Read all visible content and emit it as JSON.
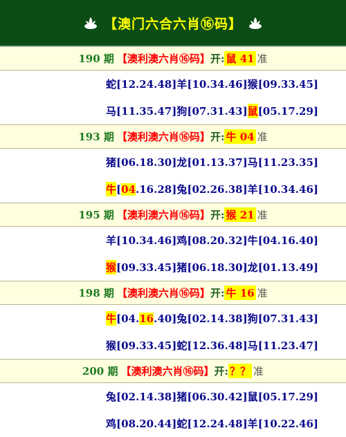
{
  "header": {
    "title": "【澳门六合六肖⑯码】"
  },
  "rounds": [
    {
      "period": "190 期",
      "title": "【澳利澳六肖⑯码】",
      "kai": "开:",
      "result": "鼠 41",
      "zhun": "准",
      "lines": [
        [
          {
            "z": "蛇",
            "n": [
              "12",
              "24",
              "48"
            ]
          },
          {
            "z": "羊",
            "n": [
              "10",
              "34",
              "46"
            ]
          },
          {
            "z": "猴",
            "n": [
              "09",
              "33",
              "45"
            ]
          }
        ],
        [
          {
            "z": "马",
            "n": [
              "11",
              "35",
              "47"
            ]
          },
          {
            "z": "狗",
            "n": [
              "07",
              "31",
              "43"
            ]
          },
          {
            "z": "鼠",
            "n": [
              "05",
              "17",
              "29"
            ],
            "hz": true
          }
        ]
      ]
    },
    {
      "period": "193 期",
      "title": "【澳利澳六肖⑯码】",
      "kai": "开:",
      "result": "牛 04",
      "zhun": "准",
      "lines": [
        [
          {
            "z": "猪",
            "n": [
              "06",
              "18",
              "30"
            ]
          },
          {
            "z": "龙",
            "n": [
              "01",
              "13",
              "37"
            ]
          },
          {
            "z": "马",
            "n": [
              "11",
              "23",
              "35"
            ]
          }
        ],
        [
          {
            "z": "牛",
            "n": [
              "04",
              "16",
              "28"
            ],
            "hz": true,
            "hn": 0
          },
          {
            "z": "兔",
            "n": [
              "02",
              "26",
              "38"
            ]
          },
          {
            "z": "羊",
            "n": [
              "10",
              "34",
              "46"
            ]
          }
        ]
      ]
    },
    {
      "period": "195 期",
      "title": "【澳利澳六肖⑯码】",
      "kai": "开:",
      "result": "猴 21",
      "zhun": "准",
      "lines": [
        [
          {
            "z": "羊",
            "n": [
              "10",
              "34",
              "46"
            ]
          },
          {
            "z": "鸡",
            "n": [
              "08",
              "20",
              "32"
            ]
          },
          {
            "z": "牛",
            "n": [
              "04",
              "16",
              "40"
            ]
          }
        ],
        [
          {
            "z": "猴",
            "n": [
              "09",
              "33",
              "45"
            ],
            "hz": true
          },
          {
            "z": "猪",
            "n": [
              "06",
              "18",
              "30"
            ]
          },
          {
            "z": "龙",
            "n": [
              "01",
              "13",
              "49"
            ]
          }
        ]
      ]
    },
    {
      "period": "198 期",
      "title": "【澳利澳六肖⑯码】",
      "kai": "开:",
      "result": "牛 16",
      "zhun": "准",
      "lines": [
        [
          {
            "z": "牛",
            "n": [
              "04",
              "16",
              "40"
            ],
            "hz": true,
            "hn": 1
          },
          {
            "z": "兔",
            "n": [
              "02",
              "14",
              "38"
            ]
          },
          {
            "z": "狗",
            "n": [
              "07",
              "31",
              "43"
            ]
          }
        ],
        [
          {
            "z": "猴",
            "n": [
              "09",
              "33",
              "45"
            ]
          },
          {
            "z": "蛇",
            "n": [
              "12",
              "36",
              "48"
            ]
          },
          {
            "z": "马",
            "n": [
              "11",
              "23",
              "47"
            ]
          }
        ]
      ]
    },
    {
      "period": "200 期",
      "title": "【澳利澳六肖⑯码】",
      "kai": "开:",
      "result": "？？",
      "zhun": "准",
      "lines": [
        [
          {
            "z": "兔",
            "n": [
              "02",
              "14",
              "38"
            ]
          },
          {
            "z": "猪",
            "n": [
              "06",
              "30",
              "42"
            ]
          },
          {
            "z": "鼠",
            "n": [
              "05",
              "17",
              "29"
            ]
          }
        ],
        [
          {
            "z": "鸡",
            "n": [
              "08",
              "20",
              "44"
            ]
          },
          {
            "z": "蛇",
            "n": [
              "12",
              "24",
              "48"
            ]
          },
          {
            "z": "羊",
            "n": [
              "10",
              "22",
              "46"
            ]
          }
        ]
      ]
    }
  ]
}
